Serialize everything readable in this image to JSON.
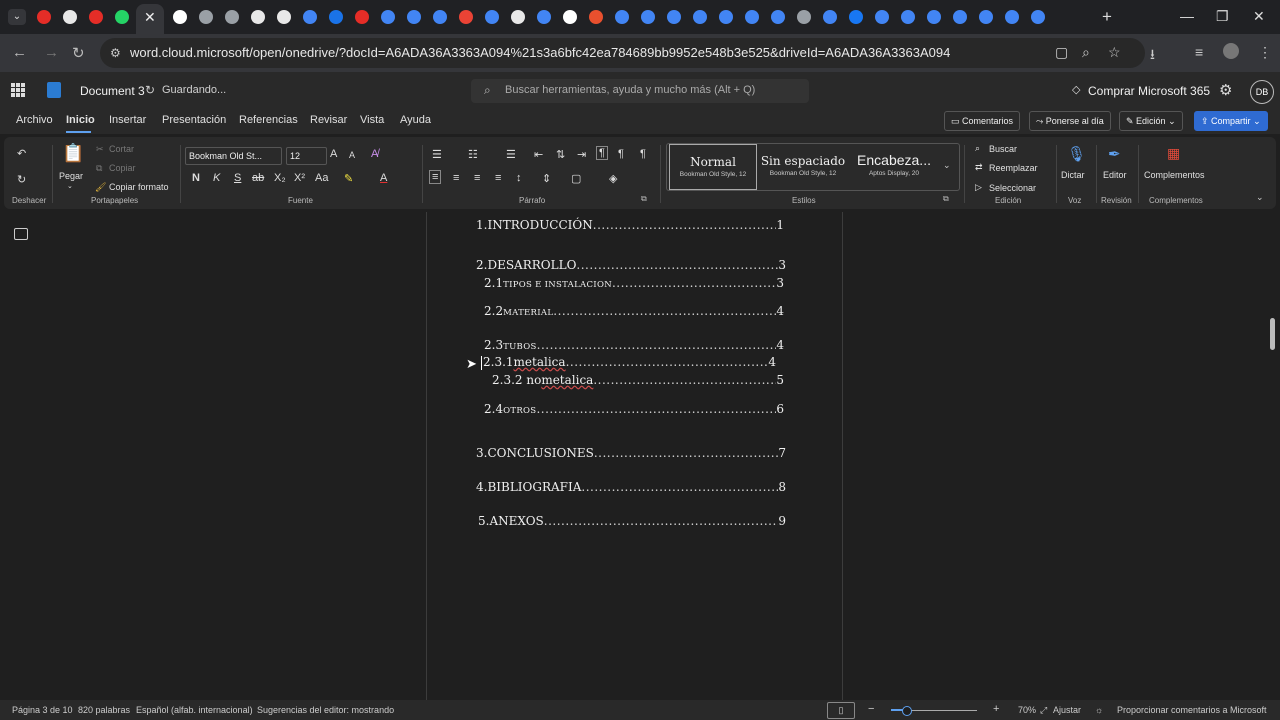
{
  "browser": {
    "url": "word.cloud.microsoft/open/onedrive/?docId=A6ADA36A3363A094%21s3a6bfc42ea784689bb9952e548b3e525&driveId=A6ADA36A3363A094",
    "tab_icon_colors": [
      "#e52d27",
      "#e8e8e8",
      "#e52d27",
      "#25d366",
      "#ffffff",
      "#9aa0a6",
      "#9aa0a6",
      "#e8e8e8",
      "#e8e8e8",
      "#4285f4",
      "#1a73e8",
      "#e52d27",
      "#4285f4",
      "#4285f4",
      "#4285f4",
      "#ea4335",
      "#4285f4",
      "#e8e8e8",
      "#4285f4",
      "#ffffff",
      "#e8502e",
      "#4285f4",
      "#4285f4",
      "#4285f4",
      "#4285f4",
      "#4285f4",
      "#4285f4",
      "#4285f4",
      "#9aa0a6",
      "#4285f4",
      "#1877f2",
      "#4285f4",
      "#4285f4",
      "#4285f4",
      "#4285f4",
      "#4285f4",
      "#4285f4",
      "#4285f4"
    ]
  },
  "word": {
    "doc_title": "Document 3",
    "save_state": "Guardando...",
    "search_placeholder": "Buscar herramientas, ayuda y mucho más (Alt + Q)",
    "buy_label": "Comprar Microsoft 365",
    "avatar_initials": "DB"
  },
  "menu": {
    "archivo": "Archivo",
    "inicio": "Inicio",
    "insertar": "Insertar",
    "presentacion": "Presentación",
    "referencias": "Referencias",
    "revisar": "Revisar",
    "vista": "Vista",
    "ayuda": "Ayuda",
    "comentarios": "Comentarios",
    "ponerse": "Ponerse al día",
    "edicion": "Edición",
    "compartir": "Compartir"
  },
  "ribbon": {
    "deshacer": "Deshacer",
    "pegar": "Pegar",
    "cortar": "Cortar",
    "copiar": "Copiar",
    "copiar_formato": "Copiar formato",
    "portapapeles": "Portapapeles",
    "font_name": "Bookman Old St...",
    "font_size": "12",
    "fuente": "Fuente",
    "bold": "N",
    "italic": "K",
    "underline": "S",
    "strike": "ab",
    "sub": "X₂",
    "sup": "X²",
    "parrafo": "Párrafo",
    "style_normal": "Normal",
    "style_normal_sub": "Bookman Old Style, 12",
    "style_sin": "Sin espaciado",
    "style_sin_sub": "Bookman Old Style, 12",
    "style_enc": "Encabeza...",
    "style_enc_sub": "Aptos Display, 20",
    "estilos": "Estilos",
    "buscar": "Buscar",
    "reemplazar": "Reemplazar",
    "seleccionar": "Seleccionar",
    "edicion_label": "Edición",
    "dictar": "Dictar",
    "voz": "Voz",
    "editor": "Editor",
    "revision": "Revisión",
    "complementos": "Complementos",
    "complementos_label": "Complementos"
  },
  "toc": [
    {
      "num": "1.",
      "title": "INTRODUCCIÓN",
      "page": "1",
      "style": "caps"
    },
    {
      "num": "2.",
      "title": "DESARROLLO",
      "page": "3",
      "style": "caps"
    },
    {
      "num": "2.1 ",
      "title": "tipos e instalacion",
      "page": "3",
      "style": "smallcaps"
    },
    {
      "num": "2.2 ",
      "title": "material",
      "page": "4",
      "style": "smallcaps"
    },
    {
      "num": "2.3 ",
      "title": "tubos",
      "page": "4",
      "style": "smallcaps"
    },
    {
      "num": "2.3.1 ",
      "title": "metalica",
      "page": "4",
      "style": "underlined"
    },
    {
      "num": "2.3.2 no ",
      "title": "metalica",
      "page": "5",
      "style": "underlined"
    },
    {
      "num": "2.4 ",
      "title": "otros",
      "page": "6",
      "style": "smallcaps"
    },
    {
      "num": "3.",
      "title": "CONCLUSIONES",
      "page": "7",
      "style": "caps"
    },
    {
      "num": "4.",
      "title": "BIBLIOGRAFIA",
      "page": "8",
      "style": "caps"
    },
    {
      "num": "5.",
      "title": "ANEXOS",
      "page": "9",
      "style": "caps"
    }
  ],
  "status": {
    "page": "Página 3 de 10",
    "words": "820 palabras",
    "language": "Español (alfab. internacional)",
    "suggestions": "Sugerencias del editor: mostrando",
    "zoom": "70%",
    "fit": "Ajustar",
    "feedback": "Proporcionar comentarios a Microsoft"
  }
}
